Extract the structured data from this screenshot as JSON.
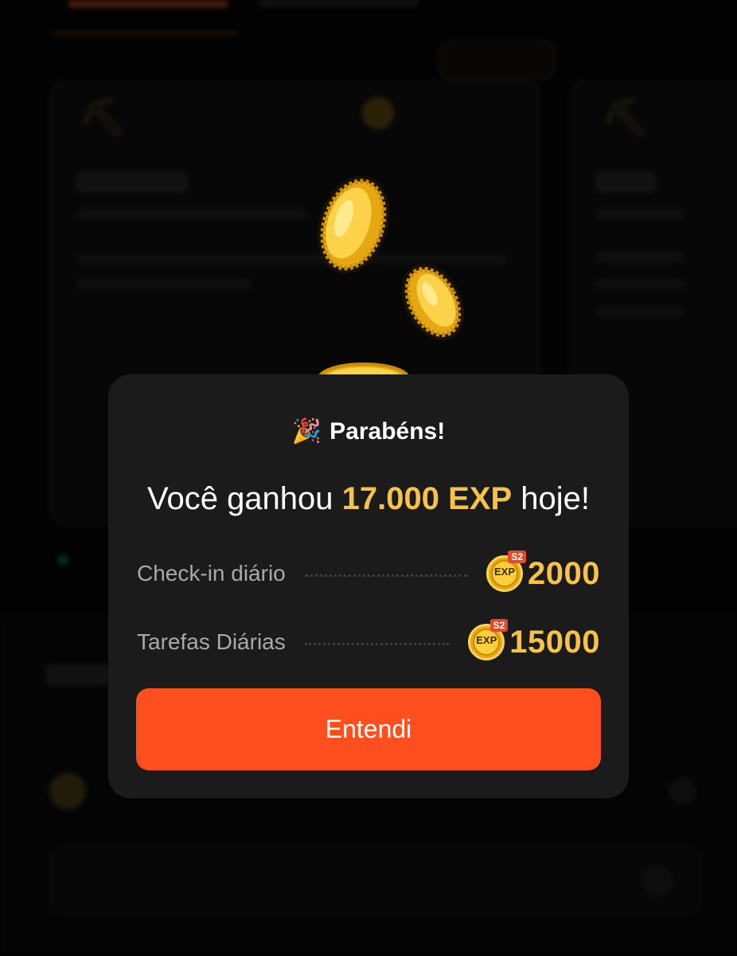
{
  "modal": {
    "title_emoji": "🎉",
    "title": "Parabéns!",
    "headline_prefix": "Você ganhou ",
    "headline_amount": "17.000 EXP",
    "headline_suffix": " hoje!",
    "rewards": [
      {
        "label": "Check-in diário",
        "badge": "EXP",
        "badge_tag": "S2",
        "value": "2000"
      },
      {
        "label": "Tarefas Diárias",
        "badge": "EXP",
        "badge_tag": "S2",
        "value": "15000"
      }
    ],
    "confirm_label": "Entendi"
  },
  "colors": {
    "accent": "#ff4f1e",
    "highlight": "#f7c24a",
    "modal_bg": "#1b1b1b"
  },
  "icons": {
    "title": "party-popper-icon",
    "reward": "exp-coin-icon",
    "decoration": "gold-coin"
  }
}
